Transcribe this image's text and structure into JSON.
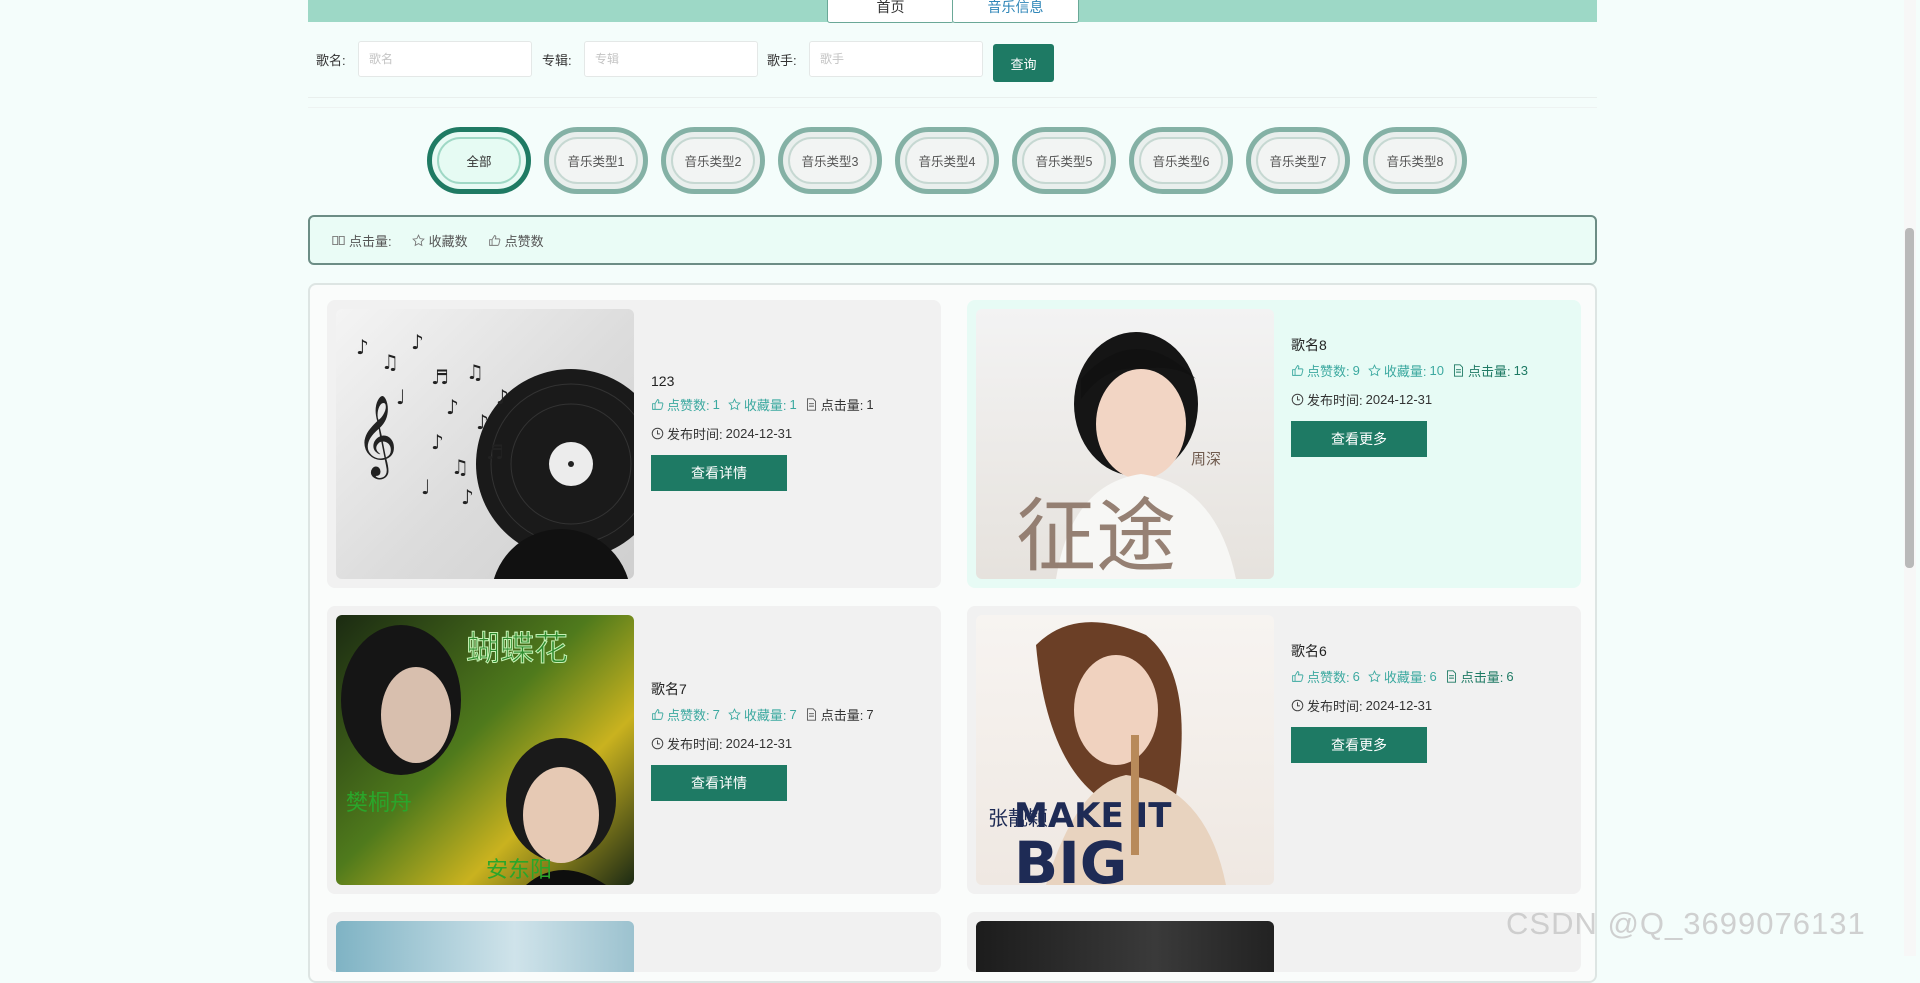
{
  "nav": {
    "tabs": [
      {
        "label": "首页"
      },
      {
        "label": "音乐信息"
      }
    ]
  },
  "search": {
    "song_label": "歌名:",
    "song_placeholder": "歌名",
    "album_label": "专辑:",
    "album_placeholder": "专辑",
    "singer_label": "歌手:",
    "singer_placeholder": "歌手",
    "button": "查询"
  },
  "categories": [
    "全部",
    "音乐类型1",
    "音乐类型2",
    "音乐类型3",
    "音乐类型4",
    "音乐类型5",
    "音乐类型6",
    "音乐类型7",
    "音乐类型8"
  ],
  "sort": {
    "clicks": "点击量:",
    "favorites": "收藏数",
    "likes": "点赞数"
  },
  "cards": [
    {
      "name": "123",
      "likes_label": "点赞数:",
      "likes": "1",
      "fav_label": "收藏量:",
      "fav": "1",
      "clicks_label": "点击量:",
      "clicks": "1",
      "date_label": "发布时间:",
      "date": "2024-12-31",
      "button": "查看详情"
    },
    {
      "name": "歌名8",
      "likes_label": "点赞数:",
      "likes": "9",
      "fav_label": "收藏量:",
      "fav": "10",
      "clicks_label": "点击量:",
      "clicks": "13",
      "date_label": "发布时间:",
      "date": "2024-12-31",
      "button": "查看更多",
      "cover_text_big": "征途",
      "cover_text_small": "周深"
    },
    {
      "name": "歌名7",
      "likes_label": "点赞数:",
      "likes": "7",
      "fav_label": "收藏量:",
      "fav": "7",
      "clicks_label": "点击量:",
      "clicks": "7",
      "date_label": "发布时间:",
      "date": "2024-12-31",
      "button": "查看详情",
      "cover_text_top": "蝴蝶花",
      "cover_text_left": "樊桐舟",
      "cover_text_right": "安东阳"
    },
    {
      "name": "歌名6",
      "likes_label": "点赞数:",
      "likes": "6",
      "fav_label": "收藏量:",
      "fav": "6",
      "clicks_label": "点击量:",
      "clicks": "6",
      "date_label": "发布时间:",
      "date": "2024-12-31",
      "button": "查看更多",
      "cover_text_make": "MAKE IT",
      "cover_text_big": "BIG",
      "cover_text_name": "张靓颖"
    }
  ],
  "watermark": "CSDN @Q_3699076131"
}
